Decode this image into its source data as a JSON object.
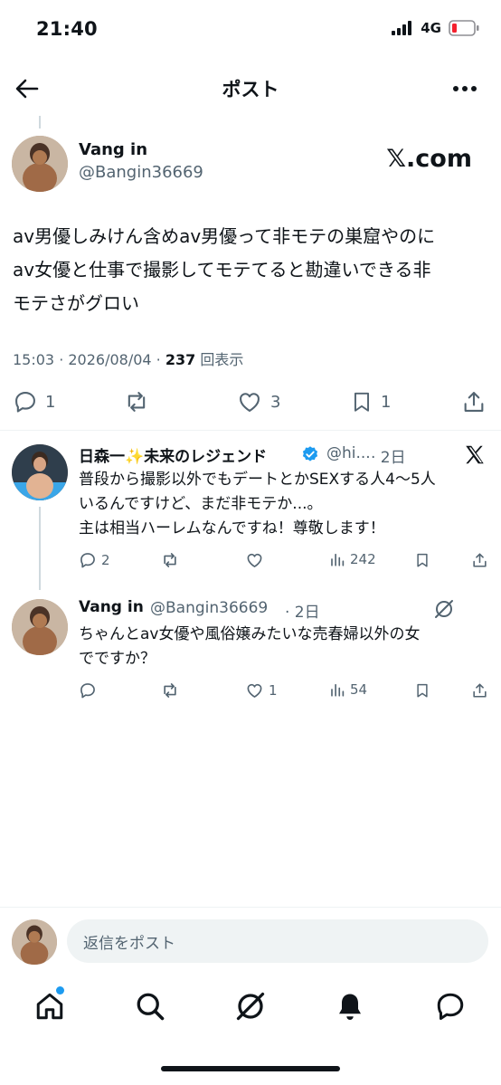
{
  "status_bar": {
    "time": "21:40",
    "network": "4G"
  },
  "header": {
    "title": "ポスト"
  },
  "post": {
    "author_name": "Vang in",
    "author_handle": "@Bangin36669",
    "brand": "𝕏.com",
    "text_lines": [
      "av男優しみけん含めav男優って非モテの巣窟やのに",
      "av女優と仕事で撮影してモテてると勘違いできる非",
      "モテさがグロい"
    ],
    "timestamp": "15:03 · 2026/08/04 · ",
    "views_count": "237",
    "views_label": " 回表示",
    "replies": "1",
    "likes": "3",
    "bookmarks": "1"
  },
  "replies": [
    {
      "name": "日森一✨未来のレジェンド",
      "handle": "@hi...",
      "time": "· 2日",
      "text_lines": [
        "普段から撮影以外でもデートとかSEXする人4〜5人",
        "いるんですけど、まだ非モテか...。",
        "主は相当ハーレムなんですね！尊敬します！"
      ],
      "reply_count": "2",
      "views": "242"
    },
    {
      "name": "Vang in",
      "handle": "@Bangin36669",
      "time": "· 2日",
      "text_lines": [
        "ちゃんとav女優や風俗嬢みたいな売春婦以外の女",
        "でですか？"
      ],
      "like_count": "1",
      "views": "54"
    }
  ],
  "compose": {
    "placeholder": "返信をポスト"
  },
  "colors": {
    "accent": "#1d9bf0",
    "text": "#0f1419",
    "secondary": "#536471",
    "battery_low": "#f4212e"
  }
}
